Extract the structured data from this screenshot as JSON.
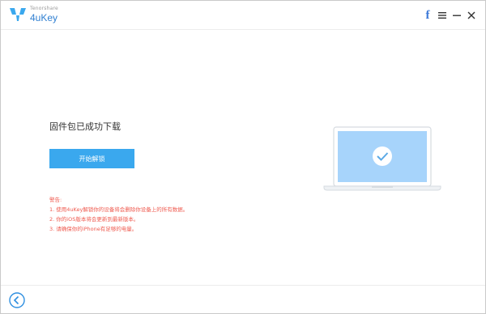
{
  "header": {
    "brand_small": "Tenorshare",
    "brand_name": "4uKey",
    "facebook_glyph": "f",
    "controls": [
      "facebook-icon",
      "menu-icon",
      "minimize-icon",
      "close-icon"
    ]
  },
  "main": {
    "success_title": "固件包已成功下载",
    "start_button_label": "开始解锁",
    "warning": {
      "title": "警告:",
      "items": [
        "1. 使用4uKey解锁你的设备将会删除你设备上的所有数据。",
        "2. 你的iOS版本将会更新到最新版本。",
        "3. 请确保你的iPhone有足够的电量。"
      ]
    },
    "illustration": "laptop-checkmark-icon"
  },
  "footer": {
    "back_icon": "back-arrow-icon"
  },
  "colors": {
    "accent": "#3aa8ee",
    "brand": "#2f7fd1",
    "warning": "#ef5a4f",
    "screen": "#a7d4fb"
  }
}
